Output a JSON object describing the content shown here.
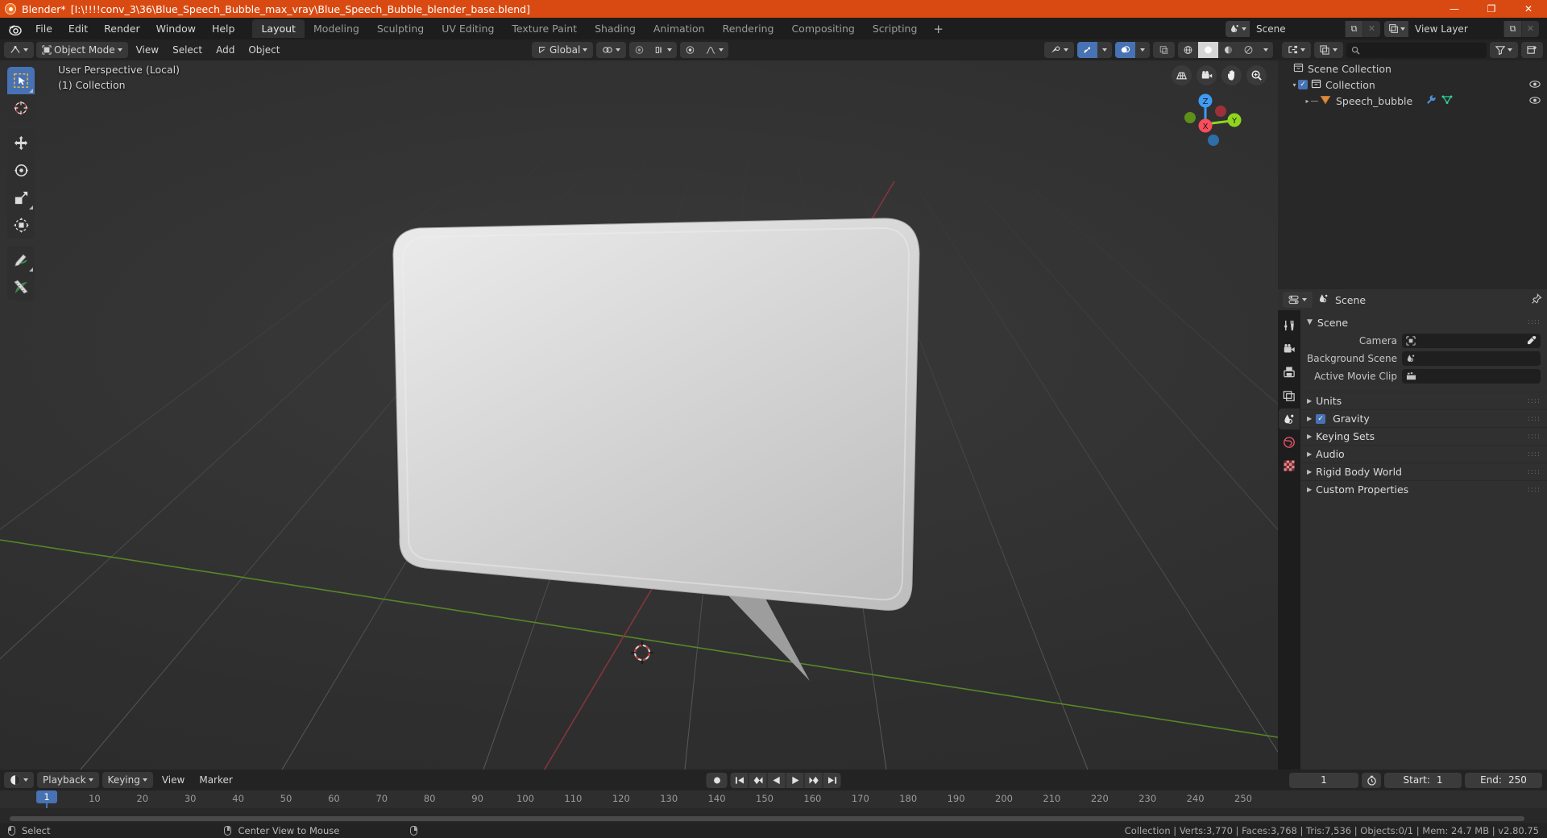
{
  "titlebar": {
    "app": "Blender*",
    "filepath": "[I:\\!!!!conv_3\\36\\Blue_Speech_Bubble_max_vray\\Blue_Speech_Bubble_blender_base.blend]",
    "minimize": "—",
    "maximize": "❐",
    "close": "✕"
  },
  "topbar": {
    "menus": [
      "File",
      "Edit",
      "Render",
      "Window",
      "Help"
    ],
    "workspaces": [
      "Layout",
      "Modeling",
      "Sculpting",
      "UV Editing",
      "Texture Paint",
      "Shading",
      "Animation",
      "Rendering",
      "Compositing",
      "Scripting"
    ],
    "active_workspace": "Layout",
    "add_workspace": "+",
    "scene_name": "Scene",
    "view_layer_name": "View Layer",
    "new_copy": "⧉",
    "unlink": "✕"
  },
  "viewport": {
    "header": {
      "mode": "Object Mode",
      "menus": [
        "View",
        "Select",
        "Add",
        "Object"
      ],
      "transform_orientation": "Global",
      "snap_label": "",
      "proportional_label": ""
    },
    "overlay_line1": "User Perspective (Local)",
    "overlay_line2": "(1) Collection",
    "toolbar_tools": [
      "select-box-tool",
      "cursor-tool",
      "move-tool",
      "rotate-tool",
      "scale-tool",
      "transform-tool",
      "annotate-tool",
      "measure-tool"
    ],
    "nav_buttons": [
      "toggle-orthographic",
      "camera-view",
      "pan-view",
      "zoom-view"
    ],
    "axis_labels": {
      "x": "X",
      "y": "Y",
      "z": "Z"
    },
    "axis_colors": {
      "x": "#fc4d5a",
      "y": "#8fd520",
      "z": "#3e9bf5"
    }
  },
  "outliner": {
    "search_placeholder": "",
    "rows": [
      {
        "label": "Scene Collection",
        "indent": 8,
        "icon": "collection-icon",
        "arrow": "",
        "checkbox": false,
        "eye": false
      },
      {
        "label": "Collection",
        "indent": 20,
        "icon": "collection-icon",
        "arrow": "▾",
        "checkbox": true,
        "eye": true
      },
      {
        "label": "Speech_bubble",
        "indent": 40,
        "icon": "mesh-object-icon",
        "arrow": "▸",
        "checkbox": false,
        "eye": true
      }
    ]
  },
  "properties": {
    "breadcrumb": "Scene",
    "tabs": [
      "tool-tab",
      "render-tab",
      "output-tab",
      "view-layer-tab",
      "scene-tab",
      "world-tab",
      "texture-tab"
    ],
    "active_tab": "scene-tab",
    "panel_title": "Scene",
    "fields": [
      {
        "label": "Camera",
        "value": "",
        "icon": "camera-icon",
        "eyedropper": true
      },
      {
        "label": "Background Scene",
        "value": "",
        "icon": "scene-icon",
        "eyedropper": false
      },
      {
        "label": "Active Movie Clip",
        "value": "",
        "icon": "clip-icon",
        "eyedropper": false
      }
    ],
    "sections": [
      {
        "label": "Units",
        "checkbox": null
      },
      {
        "label": "Gravity",
        "checkbox": true
      },
      {
        "label": "Keying Sets",
        "checkbox": null
      },
      {
        "label": "Audio",
        "checkbox": null
      },
      {
        "label": "Rigid Body World",
        "checkbox": null
      },
      {
        "label": "Custom Properties",
        "checkbox": null
      }
    ]
  },
  "timeline": {
    "menus": [
      "Playback",
      "Keying",
      "View",
      "Marker"
    ],
    "transport": [
      "record-button",
      "jump-to-start",
      "jump-prev-keyframe",
      "play-reverse",
      "play",
      "jump-next-keyframe",
      "jump-to-end"
    ],
    "current_frame": "1",
    "start_label": "Start:",
    "start_value": "1",
    "end_label": "End:",
    "end_value": "250",
    "ruler_ticks": [
      "10",
      "20",
      "30",
      "40",
      "50",
      "60",
      "70",
      "80",
      "90",
      "100",
      "110",
      "120",
      "130",
      "140",
      "150",
      "160",
      "170",
      "180",
      "190",
      "200",
      "210",
      "220",
      "230",
      "240",
      "250"
    ],
    "playhead_frame": "1"
  },
  "statusbar": {
    "left_items": [
      {
        "mouse": "left",
        "label": "Select"
      },
      {
        "mouse": "mid",
        "label": "Center View to Mouse"
      },
      {
        "mouse": "right",
        "label": ""
      }
    ],
    "stats": "Collection | Verts:3,770 | Faces:3,768 | Tris:7,536 | Objects:0/1 | Mem: 24.7 MB | v2.80.75"
  }
}
